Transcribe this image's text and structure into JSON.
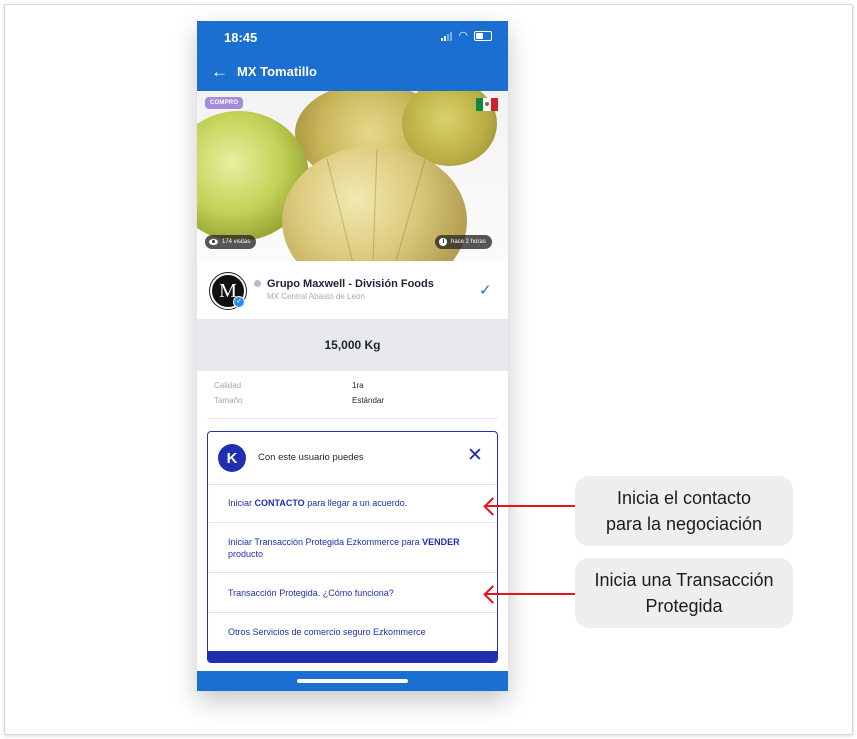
{
  "status_bar": {
    "time": "18:45"
  },
  "app_bar": {
    "title": "MX Tomatillo"
  },
  "listing": {
    "type_badge": "COMPRO",
    "views": "174 visitas",
    "posted": "hace 2 horas",
    "seller_initial": "M",
    "seller_name": "Grupo Maxwell - División Foods",
    "seller_location": "MX Central Abasto de León",
    "quantity": "15,000 Kg",
    "attributes": [
      {
        "label": "Calidad",
        "value": "1ra"
      },
      {
        "label": "Tamaño",
        "value": "Estándar"
      }
    ]
  },
  "sheet": {
    "logo": "K",
    "title": "Con este usuario puedes",
    "options": [
      {
        "before": "Iniciar ",
        "bold": "CONTACTO",
        "after": " para llegar a un acuerdo."
      },
      {
        "before": "Iniciar Transacción Protegida Ezkommerce para ",
        "bold": "VENDER",
        "after": " producto"
      },
      {
        "before": "Transacción Protegida. ¿Cómo funciona?",
        "bold": "",
        "after": ""
      },
      {
        "before": "Otros Servicios de comercio seguro Ezkommerce",
        "bold": "",
        "after": ""
      }
    ]
  },
  "annotations": [
    {
      "line1": "Inicia el contacto",
      "line2": "para la negociación"
    },
    {
      "line1": "Inicia una Transacción",
      "line2": "Protegida"
    }
  ],
  "colors": {
    "app_blue": "#1a6fd1",
    "sheet_blue": "#1f2fb0",
    "badge_purple": "#a58bdc",
    "arrow_red": "#e8121b"
  },
  "icons": [
    "back-arrow-icon",
    "signal-icon",
    "wifi-icon",
    "battery-icon",
    "eye-icon",
    "clock-icon",
    "verified-check-icon",
    "close-icon",
    "mexico-flag-icon"
  ]
}
